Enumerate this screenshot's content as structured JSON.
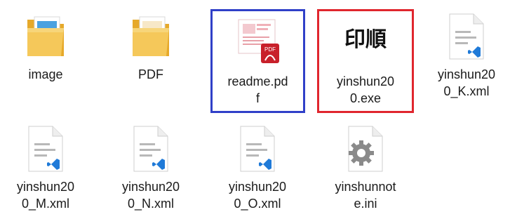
{
  "files": [
    {
      "label": "image",
      "icon": "folder-icon"
    },
    {
      "label": "PDF",
      "icon": "folder-icon"
    },
    {
      "label": "readme.pd\nf",
      "icon": "pdf-thumbnail-icon",
      "selected": "blue"
    },
    {
      "label": "yinshun20\n0.exe",
      "icon": "app-icon",
      "app_icon_text": "印順",
      "selected": "red"
    },
    {
      "label": "yinshun20\n0_K.xml",
      "icon": "xml-file-icon"
    },
    {
      "label": "yinshun20\n0_M.xml",
      "icon": "xml-file-icon"
    },
    {
      "label": "yinshun20\n0_N.xml",
      "icon": "xml-file-icon"
    },
    {
      "label": "yinshun20\n0_O.xml",
      "icon": "xml-file-icon"
    },
    {
      "label": "yinshunnot\ne.ini",
      "icon": "settings-file-icon"
    }
  ],
  "colors": {
    "selection_blue": "#3040c8",
    "selection_red": "#e0262e",
    "folder": "#f2c14e",
    "pdf_red": "#c8202a",
    "vscode_blue": "#1f7ad8"
  }
}
